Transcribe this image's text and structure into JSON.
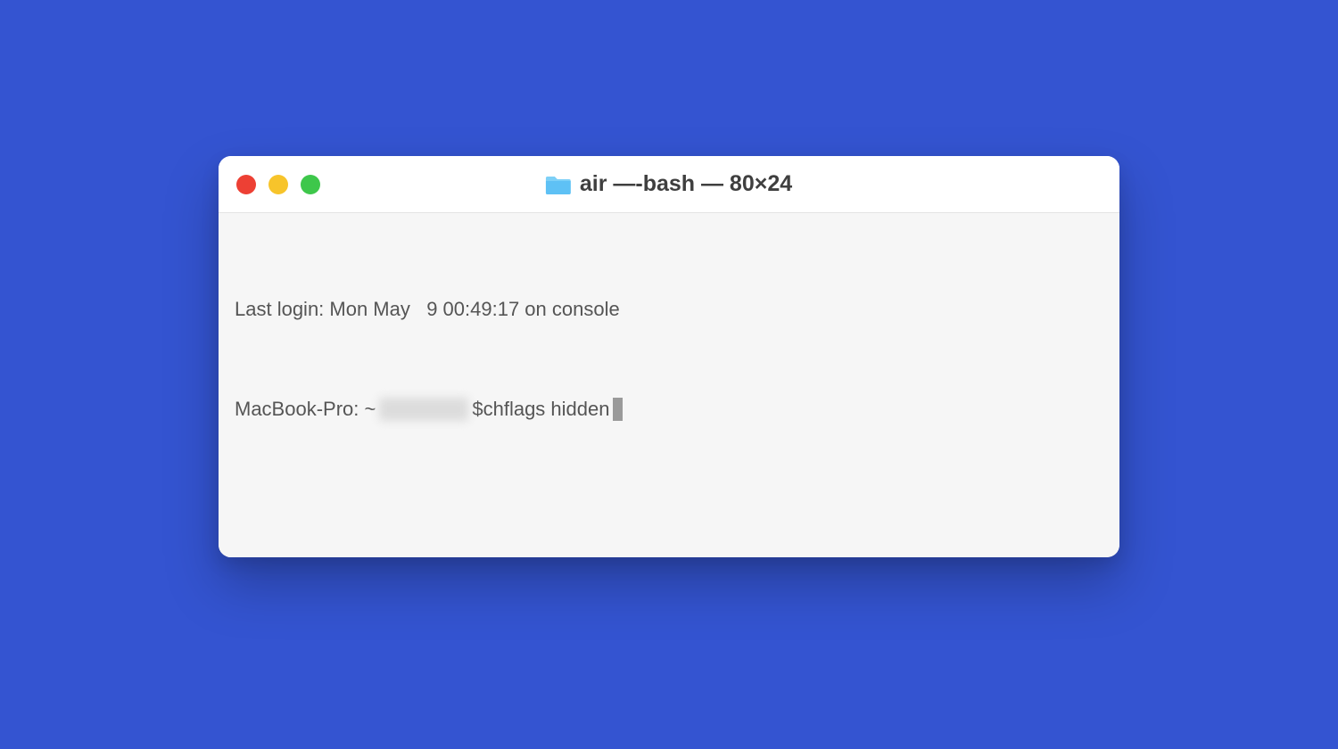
{
  "window": {
    "title": "air —-bash — 80×24"
  },
  "terminal": {
    "last_login": "Last login: Mon May   9 00:49:17 on console",
    "prompt_host": "MacBook-Pro: ~ ",
    "prompt_symbol": "$ ",
    "command": "chflags hidden "
  },
  "colors": {
    "background": "#3454d1",
    "close": "#ed4034",
    "minimize": "#f7c42b",
    "maximize": "#3ec74b",
    "folder": "#5ec1f5"
  }
}
